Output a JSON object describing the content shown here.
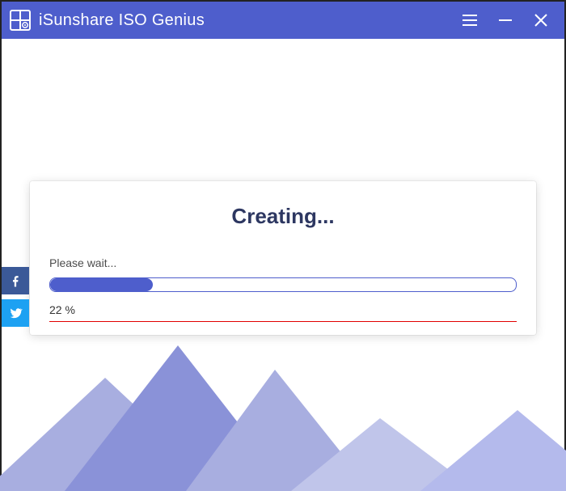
{
  "app": {
    "title": "iSunshare ISO Genius"
  },
  "social": {
    "facebook": "facebook",
    "twitter": "twitter"
  },
  "dialog": {
    "heading": "Creating...",
    "wait_text": "Please wait...",
    "percent_label": "22 %",
    "progress_value": 22
  },
  "colors": {
    "brand": "#4e5ecc"
  }
}
